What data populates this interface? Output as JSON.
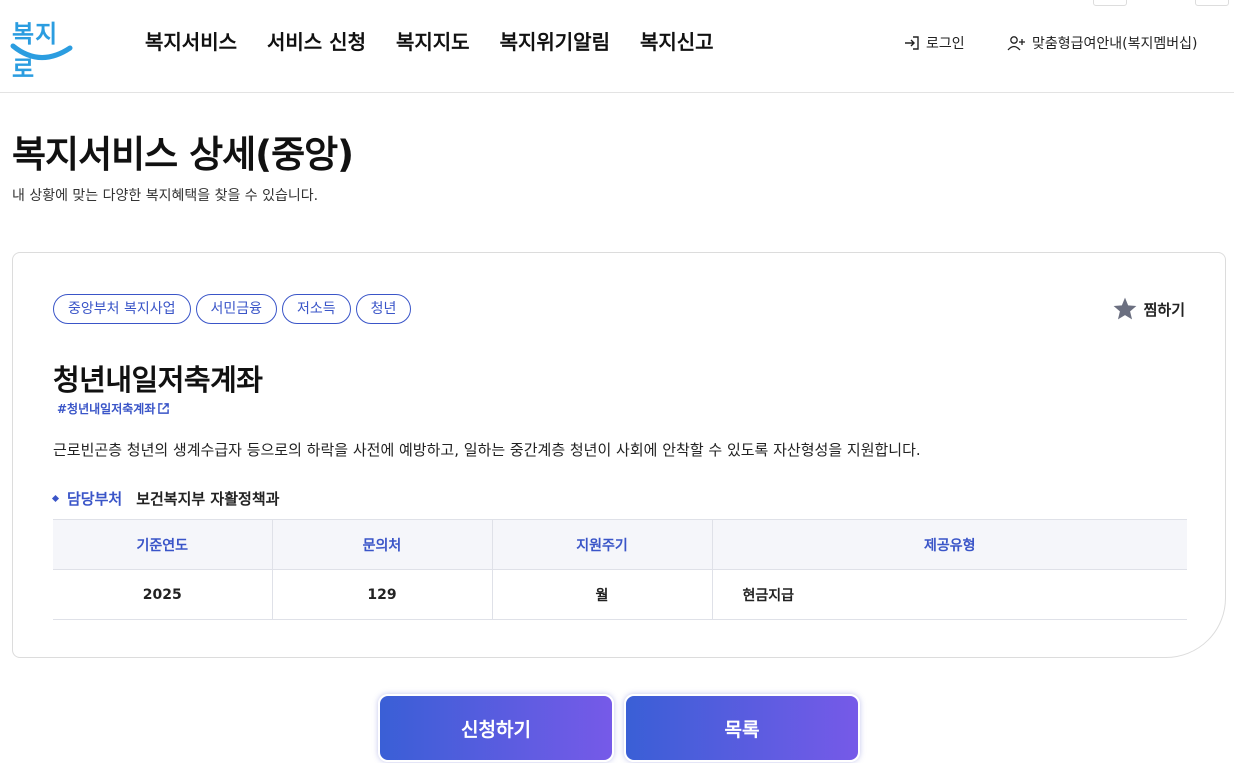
{
  "header": {
    "logo_text": "복지로",
    "nav": [
      "복지서비스",
      "서비스 신청",
      "복지지도",
      "복지위기알림",
      "복지신고"
    ],
    "login_label": "로그인",
    "member_label": "맞춤형급여안내(복지멤버십)"
  },
  "page": {
    "title": "복지서비스 상세(중앙)",
    "description": "내 상황에 맞는 다양한 복지혜택을 찾을 수 있습니다."
  },
  "service": {
    "tags": [
      "중앙부처 복지사업",
      "서민금융",
      "저소득",
      "청년"
    ],
    "favorite_label": "찜하기",
    "title": "청년내일저축계좌",
    "hashtag": "#청년내일저축계좌",
    "description": "근로빈곤층 청년의 생계수급자 등으로의 하락을 사전에 예방하고, 일하는 중간계층 청년이 사회에 안착할 수 있도록 자산형성을 지원합니다.",
    "dept_label": "담당부처",
    "dept_value": "보건복지부 자활정책과",
    "table": {
      "headers": [
        "기준연도",
        "문의처",
        "지원주기",
        "제공유형"
      ],
      "row": [
        "2025",
        "129",
        "월",
        "현금지급"
      ]
    }
  },
  "buttons": {
    "apply_label": "신청하기",
    "list_label": "목록"
  },
  "colors": {
    "accent": "#3a55c8",
    "logo": "#2b9de0",
    "button_gradient_start": "#3a5fd6",
    "button_gradient_end": "#765ae8"
  },
  "icons": {
    "login": "login-arrow-icon",
    "member": "user-plus-icon",
    "favorite": "star-icon",
    "external_link": "external-link-icon"
  }
}
